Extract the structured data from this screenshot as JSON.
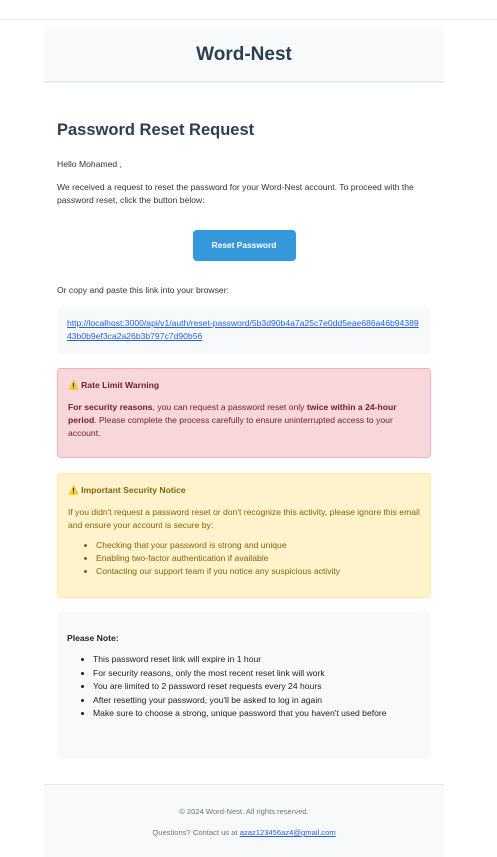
{
  "header": {
    "title": "Word-Nest"
  },
  "main": {
    "heading": "Password Reset Request",
    "greeting": "Hello Mohamed ,",
    "intro": "We received a request to reset the password for your Word-Nest account. To proceed with the password reset, click the button below:",
    "reset_button": "Reset Password",
    "copy_text": "Or copy and paste this link into your browser:",
    "reset_link": "http://localhost:3000/api/v1/auth/reset-password/5b3d90b4a7a25c7e0dd5eae686a46b9438943b0b9ef3ca2a26b3b797c7d90b56"
  },
  "rate_warning": {
    "icon": "⚠️",
    "title": "Rate Limit Warning",
    "bold1": "For security reasons",
    "text1": ", you can request a password reset only ",
    "bold2": "twice within a 24-hour period",
    "text2": ". Please complete the process carefully to ensure uninterrupted access to your account."
  },
  "security_notice": {
    "icon": "⚠️",
    "title": "Important Security Notice",
    "text": "If you didn't request a password reset or don't recognize this activity, please ignore this email and ensure your account is secure by:",
    "items": [
      "Checking that your password is strong and unique",
      "Enabling two-factor authentication if available",
      "Contacting our support team if you notice any suspicious activity"
    ]
  },
  "note": {
    "title": "Please Note:",
    "items": [
      "This password reset link will expire in 1 hour",
      "For security reasons, only the most recent reset link will work",
      "You are limited to 2 password reset requests every 24 hours",
      "After resetting your password, you'll be asked to log in again",
      "Make sure to choose a strong, unique password that you haven't used before"
    ]
  },
  "footer": {
    "copyright": "© 2024 Word-Nest. All rights reserved.",
    "contact_prefix": "Questions? Contact us at ",
    "email": "azaz123456az4@gmail.com"
  }
}
